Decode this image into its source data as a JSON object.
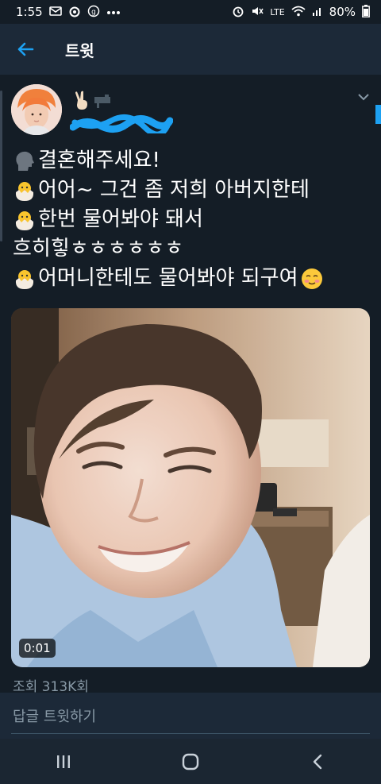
{
  "status_bar": {
    "time": "1:55",
    "battery": "80%",
    "network": "LTE"
  },
  "header": {
    "title": "트윗"
  },
  "tweet": {
    "lines": [
      {
        "emoji": "speaking-head",
        "text": "결혼해주세요!"
      },
      {
        "emoji": "hatching-chick",
        "text": "어어~ 그건 좀 저희 아버지한테"
      },
      {
        "emoji": "hatching-chick",
        "text": "한번 물어봐야 돼서"
      },
      {
        "emoji": "",
        "text": "흐히힣ㅎㅎㅎㅎㅎㅎ"
      },
      {
        "emoji": "hatching-chick",
        "text": "어머니한테도 물어봐야 되구여",
        "trail_emoji": "smiling-face"
      }
    ],
    "video_duration": "0:01",
    "views": "조회 313K회"
  },
  "reply": {
    "placeholder": "답글 트윗하기"
  },
  "colors": {
    "background": "#141d26",
    "header": "#1c2938",
    "accent": "#1da1f2",
    "muted": "#8899a6"
  }
}
